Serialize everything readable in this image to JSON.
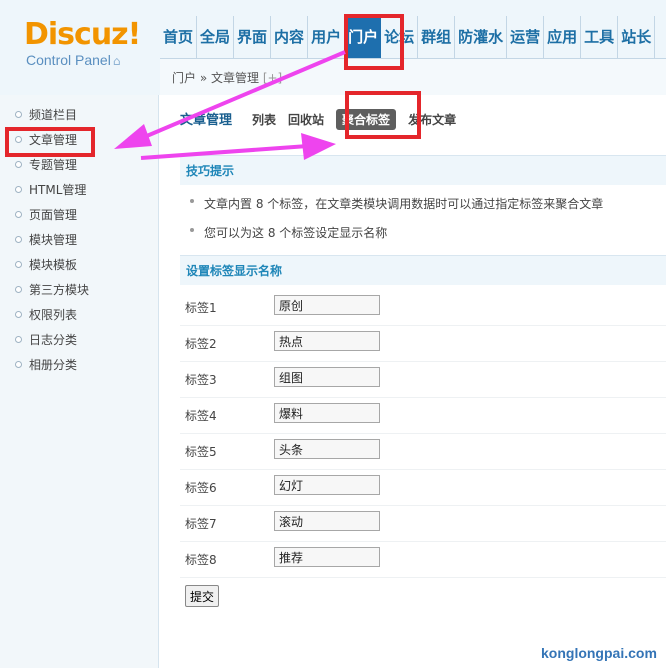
{
  "logo": {
    "brand": "Discuz!",
    "sub": "Control Panel"
  },
  "topnav": {
    "items": [
      "首页",
      "全局",
      "界面",
      "内容",
      "用户",
      "门户",
      "论坛",
      "群组",
      "防灌水",
      "运营",
      "应用",
      "工具",
      "站长"
    ],
    "active_index": 5
  },
  "breadcrumb": {
    "text": "门户 » 文章管理",
    "plus": "[+]"
  },
  "sidebar": {
    "items": [
      "频道栏目",
      "文章管理",
      "专题管理",
      "HTML管理",
      "页面管理",
      "模块管理",
      "模块模板",
      "第三方模块",
      "权限列表",
      "日志分类",
      "相册分类"
    ]
  },
  "main": {
    "title": "文章管理",
    "tabs": [
      "列表",
      "回收站",
      "聚合标签",
      "发布文章"
    ],
    "active_tab": "聚合标签",
    "tips_heading": "技巧提示",
    "tips": [
      "文章内置 8 个标签，在文章类模块调用数据时可以通过指定标签来聚合文章",
      "您可以为这 8 个标签设定显示名称"
    ],
    "form_heading": "设置标签显示名称",
    "fields": [
      {
        "label": "标签1",
        "value": "原创"
      },
      {
        "label": "标签2",
        "value": "热点"
      },
      {
        "label": "标签3",
        "value": "组图"
      },
      {
        "label": "标签4",
        "value": "爆料"
      },
      {
        "label": "标签5",
        "value": "头条"
      },
      {
        "label": "标签6",
        "value": "幻灯"
      },
      {
        "label": "标签7",
        "value": "滚动"
      },
      {
        "label": "标签8",
        "value": "推荐"
      }
    ],
    "submit_label": "提交"
  },
  "watermark": "konglongpai.com",
  "colors": {
    "annotation_red": "#e4262b",
    "annotation_arrow": "#ee44ee",
    "nav_active": "#1e6fae",
    "logo_orange": "#f29400"
  }
}
